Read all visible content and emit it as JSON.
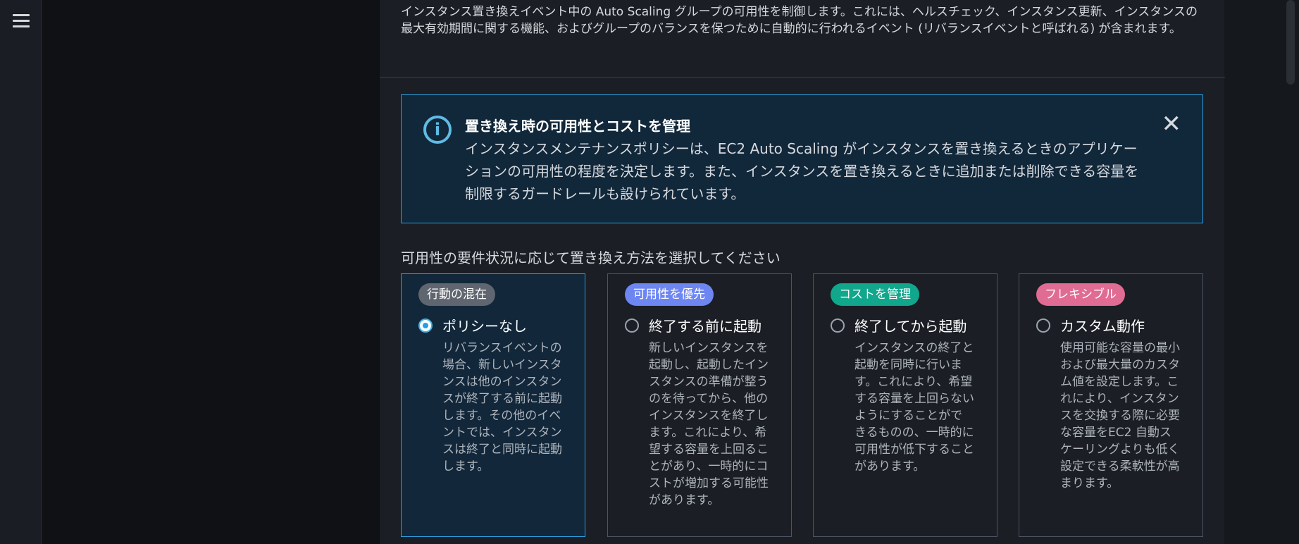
{
  "header": {
    "description": "インスタンス置き換えイベント中の Auto Scaling グループの可用性を制御します。これには、ヘルスチェック、インスタンス更新、インスタンスの最大有効期間に関する機能、およびグループのバランスを保つために自動的に行われるイベント (リバランスイベントと呼ばれる) が含まれます。"
  },
  "info": {
    "title": "置き換え時の可用性とコストを管理",
    "body": "インスタンスメンテナンスポリシーは、EC2 Auto Scaling がインスタンスを置き換えるときのアプリケーションの可用性の程度を決定します。また、インスタンスを置き換えるときに追加または削除できる容量を制限するガードレールも設けられています。",
    "close_glyph": "✕"
  },
  "choice": {
    "label": "可用性の要件状況に応じて置き換え方法を選択してください",
    "options": [
      {
        "badge": "行動の混在",
        "badge_color": "#5f6670",
        "title": "ポリシーなし",
        "desc": "リバランスイベントの場合、新しいインスタンスは他のインスタンスが終了する前に起動します。その他のイベントでは、インスタンスは終了と同時に起動します。",
        "selected": true
      },
      {
        "badge": "可用性を優先",
        "badge_color": "#6d86f2",
        "title": "終了する前に起動",
        "desc": "新しいインスタンスを起動し、起動したインスタンスの準備が整うのを待ってから、他のインスタンスを終了します。これにより、希望する容量を上回ることがあり、一時的にコストが増加する可能性があります。",
        "selected": false
      },
      {
        "badge": "コストを管理",
        "badge_color": "#11a78c",
        "title": "終了してから起動",
        "desc": "インスタンスの終了と起動を同時に行います。これにより、希望する容量を上回らないようにすることができるものの、一時的に可用性が低下することがあります。",
        "selected": false
      },
      {
        "badge": "フレキシブル",
        "badge_color": "#e06c93",
        "title": "カスタム動作",
        "desc": "使用可能な容量の最小および最大量のカスタム値を設定します。これにより、インスタンスを交換する際に必要な容量をEC2 自動スケーリングよりも低く設定できる柔軟性が高まります。",
        "selected": false
      }
    ]
  }
}
